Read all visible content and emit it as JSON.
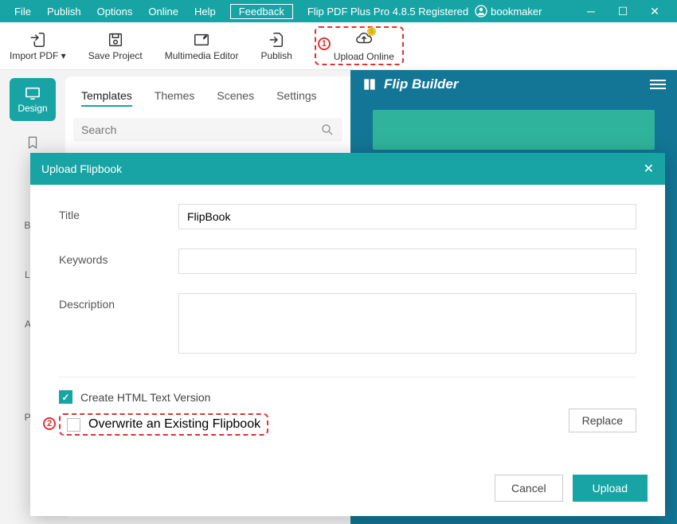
{
  "menubar": {
    "file": "File",
    "publish": "Publish",
    "options": "Options",
    "online": "Online",
    "help": "Help",
    "feedback": "Feedback",
    "app_title": "Flip PDF Plus Pro 4.8.5 Registered",
    "username": "bookmaker"
  },
  "toolbar": {
    "import": "Import PDF ▾",
    "save": "Save Project",
    "multimedia": "Multimedia Editor",
    "publish": "Publish",
    "upload": "Upload Online"
  },
  "callouts": {
    "one": "1",
    "two": "2"
  },
  "sidebar": {
    "design": "Design",
    "bookmark_partial": "Boo",
    "language_partial": "Lan",
    "assistant_partial": "Ass",
    "password_partial": "Pas"
  },
  "tabs": {
    "templates": "Templates",
    "themes": "Themes",
    "scenes": "Scenes",
    "settings": "Settings"
  },
  "search": {
    "placeholder": "Search"
  },
  "preview": {
    "brand": "Flip Builder"
  },
  "dialog": {
    "title": "Upload Flipbook",
    "labels": {
      "title": "Title",
      "keywords": "Keywords",
      "description": "Description"
    },
    "values": {
      "title": "FlipBook",
      "keywords": "",
      "description": ""
    },
    "create_html": "Create HTML Text Version",
    "overwrite": "Overwrite an Existing Flipbook",
    "replace": "Replace",
    "cancel": "Cancel",
    "upload": "Upload"
  }
}
